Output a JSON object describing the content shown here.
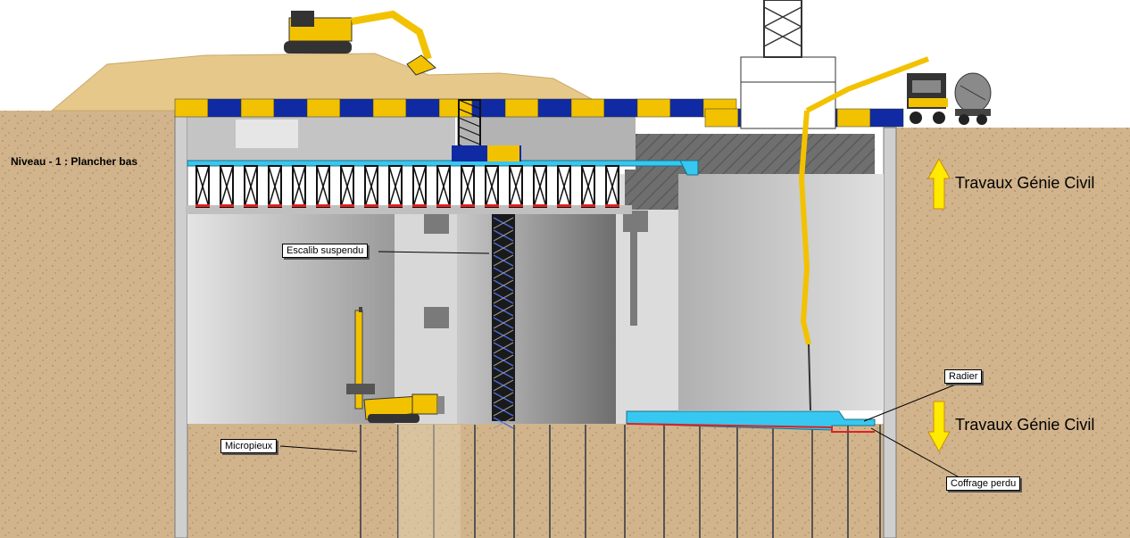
{
  "labels": {
    "level": "Niveau - 1 : Plancher bas",
    "escalib": "Escalib suspendu",
    "micropieux": "Micropieux",
    "radier": "Radier",
    "coffrage": "Coffrage perdu",
    "travaux_up": "Travaux Génie Civil",
    "travaux_down": "Travaux Génie Civil"
  },
  "colors": {
    "ground": "#d2b48c",
    "sand_mound": "#e6c98a",
    "concrete_light": "#d9d9d9",
    "concrete_mid": "#bfbfbf",
    "concrete_dark": "#8c8c8c",
    "steel_blue": "#0f2aa3",
    "machine_yellow": "#f2c200",
    "slab_cyan": "#36c8f0",
    "arrow_yellow": "#ffea00",
    "formwork_red": "#e02020"
  },
  "icons": {
    "excavator": "excavator-icon",
    "drill_rig": "drill-rig-icon",
    "pump_truck": "concrete-pump-truck-icon",
    "mixer_truck": "mixer-truck-icon",
    "arrow_up": "arrow-up-icon",
    "arrow_down": "arrow-down-icon"
  }
}
